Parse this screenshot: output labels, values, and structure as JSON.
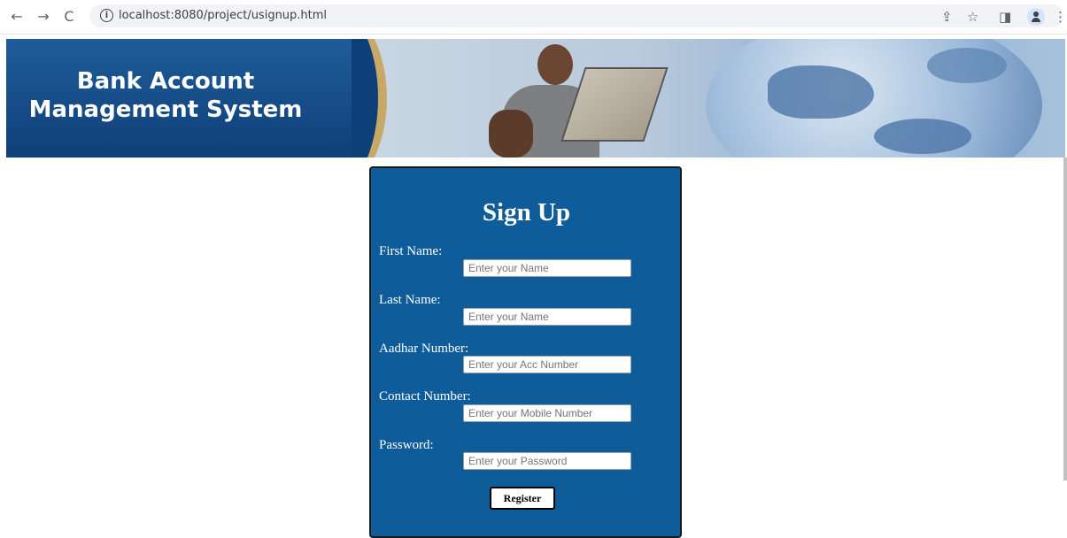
{
  "browser": {
    "back_icon": "←",
    "forward_icon": "→",
    "reload_icon": "C",
    "info_icon": "i",
    "url": "localhost:8080/project/usignup.html",
    "share_icon": "⇪",
    "star_icon": "☆",
    "sidepanel_icon": "◨",
    "menu_icon": "⋮"
  },
  "banner": {
    "title_line1": "Bank Account",
    "title_line2": "Management System"
  },
  "form": {
    "title": "Sign Up",
    "fields": [
      {
        "label": "First Name:",
        "placeholder": "Enter your Name"
      },
      {
        "label": "Last Name:",
        "placeholder": "Enter your Name"
      },
      {
        "label": "Aadhar Number:",
        "placeholder": "Enter your Acc Number"
      },
      {
        "label": "Contact Number:",
        "placeholder": "Enter your Mobile Number"
      },
      {
        "label": "Password:",
        "placeholder": "Enter your Password"
      }
    ],
    "register_label": "Register"
  },
  "colors": {
    "card_bg": "#0f5c9a",
    "banner_blue": "#0f3f78",
    "banner_gold": "#c8a866"
  }
}
